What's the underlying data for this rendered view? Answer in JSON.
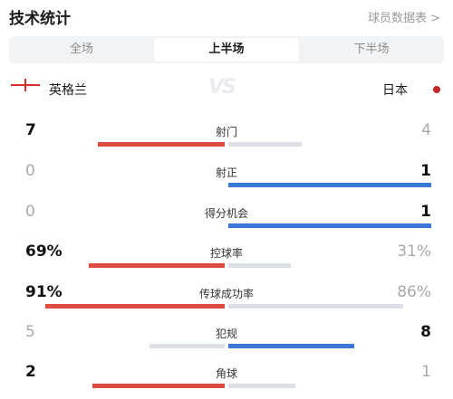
{
  "header": {
    "title": "技术统计",
    "more_label": "球员数据表 >"
  },
  "tabs": [
    {
      "label": "全场",
      "active": false
    },
    {
      "label": "上半场",
      "active": true
    },
    {
      "label": "下半场",
      "active": false
    }
  ],
  "teams": {
    "home": "英格兰",
    "away": "日本",
    "vs": "VS"
  },
  "colors": {
    "home_bar": "#dd4b3e",
    "away_bar": "#3a78d8",
    "track": "#e3e5ea"
  },
  "stats": [
    {
      "label": "射门",
      "home": "7",
      "away": "4",
      "home_frac": 0.64,
      "away_frac": 0.36,
      "leader": "home"
    },
    {
      "label": "射正",
      "home": "0",
      "away": "1",
      "home_frac": 0.0,
      "away_frac": 1.0,
      "leader": "away"
    },
    {
      "label": "得分机会",
      "home": "0",
      "away": "1",
      "home_frac": 0.0,
      "away_frac": 1.0,
      "leader": "away"
    },
    {
      "label": "控球率",
      "home": "69%",
      "away": "31%",
      "home_frac": 0.69,
      "away_frac": 0.31,
      "leader": "home"
    },
    {
      "label": "传球成功率",
      "home": "91%",
      "away": "86%",
      "home_frac": 0.91,
      "away_frac": 0.86,
      "leader": "home"
    },
    {
      "label": "犯规",
      "home": "5",
      "away": "8",
      "home_frac": 0.38,
      "away_frac": 0.62,
      "leader": "away"
    },
    {
      "label": "角球",
      "home": "2",
      "away": "1",
      "home_frac": 0.67,
      "away_frac": 0.33,
      "leader": "home"
    }
  ]
}
